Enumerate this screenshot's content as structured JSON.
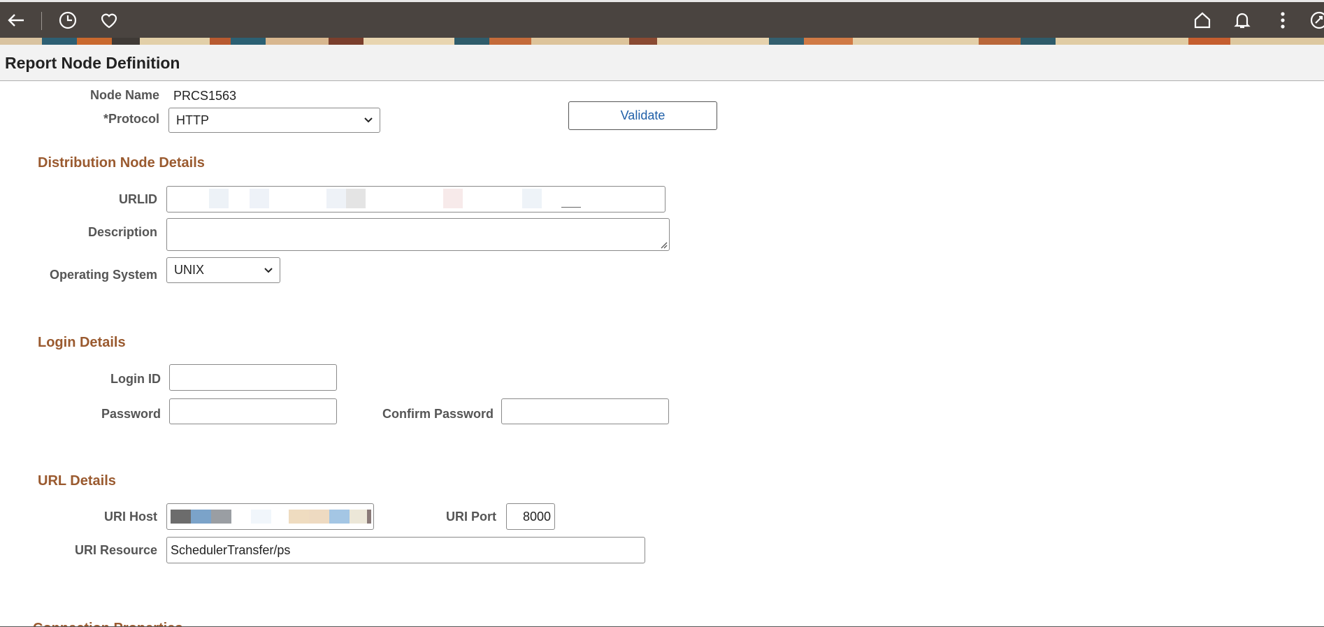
{
  "topbar": {
    "icons": [
      "back-arrow-icon",
      "recent-history-icon",
      "favorites-heart-icon",
      "home-icon",
      "notifications-bell-icon",
      "actions-menu-icon",
      "navbar-icon"
    ]
  },
  "page": {
    "title": "Report Node Definition"
  },
  "header_fields": {
    "node_name_label": "Node Name",
    "node_name_value": "PRCS1563",
    "protocol_label": "*Protocol",
    "protocol_value": "HTTP",
    "validate_label": "Validate"
  },
  "distribution": {
    "title": "Distribution Node Details",
    "urlid_label": "URLID",
    "urlid_value": "",
    "description_label": "Description",
    "description_value": "",
    "os_label": "Operating System",
    "os_value": "UNIX"
  },
  "login": {
    "title": "Login Details",
    "login_id_label": "Login ID",
    "login_id_value": "",
    "password_label": "Password",
    "password_value": "",
    "confirm_password_label": "Confirm Password",
    "confirm_password_value": ""
  },
  "url": {
    "title": "URL Details",
    "uri_host_label": "URI Host",
    "uri_host_value": "",
    "uri_port_label": "URI Port",
    "uri_port_value": "8000",
    "uri_resource_label": "URI Resource",
    "uri_resource_value": "SchedulerTransfer/ps"
  },
  "connection": {
    "title": "Connection Properties"
  },
  "colors": {
    "topbar": "#4a4440",
    "section_heading": "#9a5a2f",
    "link": "#1f5fa8"
  }
}
